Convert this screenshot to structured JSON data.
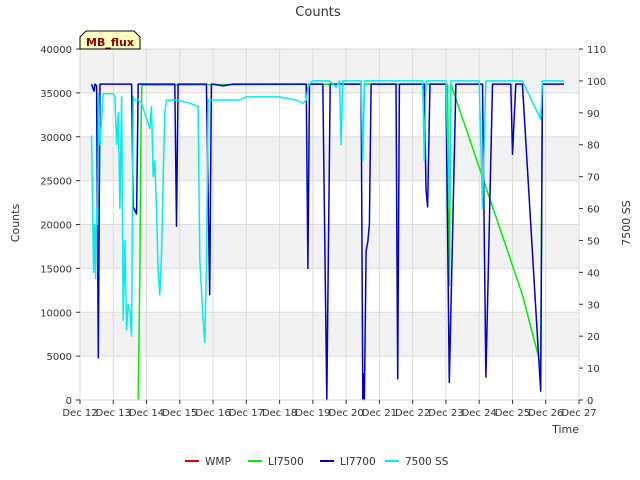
{
  "chart_data": {
    "type": "line",
    "title": "Counts",
    "xlabel": "Time",
    "ylabel": "Counts",
    "y2label": "7500 SS",
    "badge": "MB_flux",
    "xlim": [
      12,
      27
    ],
    "ylim": [
      0,
      40000
    ],
    "y2lim": [
      0,
      110
    ],
    "x_ticks": [
      {
        "v": 12,
        "label": "Dec 12"
      },
      {
        "v": 13,
        "label": "Dec 13"
      },
      {
        "v": 14,
        "label": "Dec 14"
      },
      {
        "v": 15,
        "label": "Dec 15"
      },
      {
        "v": 16,
        "label": "Dec 16"
      },
      {
        "v": 17,
        "label": "Dec 17"
      },
      {
        "v": 18,
        "label": "Dec 18"
      },
      {
        "v": 19,
        "label": "Dec 19"
      },
      {
        "v": 20,
        "label": "Dec 20"
      },
      {
        "v": 21,
        "label": "Dec 21"
      },
      {
        "v": 22,
        "label": "Dec 22"
      },
      {
        "v": 23,
        "label": "Dec 23"
      },
      {
        "v": 24,
        "label": "Dec 24"
      },
      {
        "v": 25,
        "label": "Dec 25"
      },
      {
        "v": 26,
        "label": "Dec 26"
      },
      {
        "v": 27,
        "label": "Dec 27"
      }
    ],
    "y_ticks": [
      0,
      5000,
      10000,
      15000,
      20000,
      25000,
      30000,
      35000,
      40000
    ],
    "y2_ticks": [
      0,
      10,
      20,
      30,
      40,
      50,
      60,
      70,
      80,
      90,
      100,
      110
    ],
    "grid": true,
    "legend_position": "bottom",
    "series": [
      {
        "name": "WMP",
        "color": "#dd0000",
        "axis": "left",
        "x": [],
        "y": []
      },
      {
        "name": "LI7500",
        "color": "#00ee00",
        "axis": "left",
        "x": [
          13.75,
          13.8,
          13.83,
          13.86,
          13.88,
          20.45,
          20.5,
          20.55,
          20.6,
          23.05,
          23.1,
          23.15,
          25.3,
          25.85,
          25.9
        ],
        "y": [
          0,
          15000,
          30000,
          36000,
          35900,
          36000,
          27500,
          36000,
          36000,
          36000,
          13000,
          36000,
          12000,
          4000,
          36000
        ]
      },
      {
        "name": "LI7700",
        "color": "#0000cc",
        "axis": "left",
        "x": [
          12.35,
          12.42,
          12.45,
          12.5,
          12.55,
          12.6,
          12.65,
          12.7,
          13.55,
          13.6,
          13.7,
          13.75,
          13.8,
          14.85,
          14.9,
          14.95,
          15.8,
          15.9,
          15.95,
          16.0,
          16.3,
          16.6,
          16.9,
          17.4,
          17.8,
          18.6,
          18.8,
          18.85,
          18.9,
          19.0,
          19.3,
          19.42,
          19.52,
          19.6,
          20.45,
          20.5,
          20.52,
          20.55,
          20.6,
          20.65,
          20.7,
          20.75,
          20.8,
          21.5,
          21.55,
          21.6,
          22.35,
          22.4,
          22.45,
          22.52,
          22.6,
          23.0,
          23.1,
          23.3,
          23.4,
          24.1,
          24.2,
          24.4,
          24.5,
          24.95,
          25.0,
          25.1,
          25.3,
          25.85,
          25.9,
          26.0,
          26.55
        ],
        "y": [
          36000,
          35200,
          36000,
          35800,
          4800,
          36000,
          36000,
          36000,
          36000,
          22000,
          21200,
          36000,
          36000,
          36000,
          19800,
          36000,
          36000,
          12000,
          36000,
          36000,
          35800,
          36000,
          36000,
          36000,
          36000,
          36000,
          36000,
          15000,
          36000,
          36000,
          36000,
          0,
          36000,
          36000,
          36000,
          0,
          3000,
          0,
          17000,
          18000,
          20000,
          36000,
          36000,
          36000,
          2400,
          36000,
          36000,
          24000,
          22000,
          36000,
          36000,
          36000,
          2000,
          36000,
          36000,
          36000,
          2600,
          36000,
          36000,
          36000,
          28000,
          36000,
          36000,
          1000,
          36000,
          36000,
          36000
        ]
      },
      {
        "name": "7500 SS",
        "color": "#00eeee",
        "axis": "right",
        "x": [
          12.35,
          12.38,
          12.41,
          12.44,
          12.47,
          12.5,
          12.53,
          12.56,
          12.6,
          12.7,
          13.0,
          13.05,
          13.1,
          13.15,
          13.2,
          13.25,
          13.3,
          13.35,
          13.4,
          13.45,
          13.5,
          13.55,
          13.6,
          13.65,
          13.7,
          13.75,
          13.85,
          14.1,
          14.15,
          14.2,
          14.25,
          14.3,
          14.35,
          14.4,
          14.45,
          14.5,
          14.55,
          14.6,
          14.7,
          14.9,
          15.3,
          15.55,
          15.6,
          15.7,
          15.75,
          15.8,
          15.85,
          15.9,
          16.0,
          16.3,
          16.8,
          17.0,
          17.5,
          18.0,
          18.5,
          18.7,
          18.8,
          18.85,
          18.9,
          19.0,
          19.1,
          19.5,
          19.7,
          19.8,
          19.85,
          19.9,
          20.4,
          20.45,
          20.5,
          20.55,
          20.6,
          20.7,
          21.0,
          21.5,
          21.7,
          22.0,
          22.2,
          22.3,
          22.35,
          22.4,
          22.45,
          22.5,
          23.0,
          23.1,
          23.15,
          23.2,
          23.3,
          24.0,
          24.1,
          24.2,
          24.5,
          25.0,
          25.3,
          25.85,
          25.9,
          26.55
        ],
        "y": [
          83,
          60,
          40,
          55,
          38,
          60,
          55,
          96,
          80,
          96,
          96,
          95,
          80,
          90,
          60,
          95,
          25,
          50,
          22,
          30,
          28,
          20,
          95,
          94,
          94,
          94,
          93,
          85,
          92,
          70,
          75,
          60,
          40,
          33,
          45,
          70,
          90,
          94,
          94,
          94,
          93,
          92,
          44,
          25,
          18,
          40,
          94,
          94,
          94,
          94,
          94,
          95,
          95,
          95,
          94,
          93,
          94,
          98,
          99,
          100,
          100,
          100,
          98,
          100,
          80,
          100,
          100,
          100,
          75,
          100,
          100,
          100,
          100,
          100,
          100,
          100,
          100,
          100,
          75,
          100,
          100,
          100,
          100,
          60,
          100,
          100,
          100,
          100,
          60,
          100,
          100,
          100,
          100,
          88,
          100,
          100
        ]
      }
    ]
  }
}
